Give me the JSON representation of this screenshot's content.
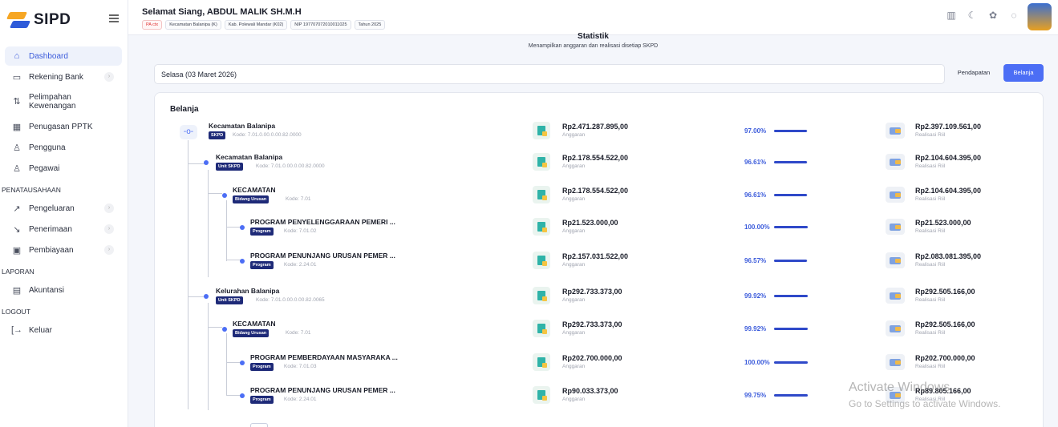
{
  "app": {
    "logo_text": "SIPD"
  },
  "sidebar": {
    "items": [
      {
        "label": "Dashboard",
        "icon": "home-icon"
      },
      {
        "label": "Rekening Bank",
        "icon": "bank-card-icon"
      },
      {
        "label": "Pelimpahan Kewenangan",
        "icon": "delegation-icon"
      },
      {
        "label": "Penugasan PPTK",
        "icon": "table-icon"
      },
      {
        "label": "Pengguna",
        "icon": "user-icon"
      },
      {
        "label": "Pegawai",
        "icon": "users-icon"
      }
    ],
    "section_penatausahaan": "PENATAUSAHAAN",
    "items2": [
      {
        "label": "Pengeluaran",
        "icon": "trend-up-icon"
      },
      {
        "label": "Penerimaan",
        "icon": "trend-down-icon"
      },
      {
        "label": "Pembiayaan",
        "icon": "wallet-icon"
      }
    ],
    "section_laporan": "LAPORAN",
    "akuntansi": "Akuntansi",
    "section_logout": "LOGOUT",
    "keluar": "Keluar"
  },
  "header": {
    "greeting": "Selamat Siang, ABDUL MALIK SH.M.H",
    "chips": [
      "PA ctx",
      "Kecamatan Balanipa (K)",
      "Kab. Polewali Mandar (K02)",
      "NIP 197707072010011025",
      "Tahun 2025"
    ]
  },
  "main": {
    "title": "Statistik",
    "subtitle": "Menampilkan anggaran dan realisasi disetiap SKPD",
    "date_value": "Selasa (03 Maret 2026)",
    "tab_pendapatan": "Pendapatan",
    "tab_belanja": "Belanja",
    "section_title": "Belanja",
    "anggaran_label": "Anggaran",
    "realisasi_label": "Realisasi Riil",
    "rows": [
      {
        "name": "Kecamatan Balanipa",
        "badge": "SKPD",
        "kode": "Kode: 7.01.0.00.0.00.82.0000",
        "anggaran": "Rp2.471.287.895,00",
        "pct": "97.00%",
        "pct_value": 97.0,
        "realisasi": "Rp2.397.109.561,00"
      },
      {
        "name": "Kecamatan Balanipa",
        "badge": "Unit SKPD",
        "kode": "Kode: 7.01.0.00.0.00.82.0000",
        "anggaran": "Rp2.178.554.522,00",
        "pct": "96.61%",
        "pct_value": 96.61,
        "realisasi": "Rp2.104.604.395,00"
      },
      {
        "name": "KECAMATAN",
        "badge": "Bidang Urusan",
        "kode": "Kode: 7.01",
        "anggaran": "Rp2.178.554.522,00",
        "pct": "96.61%",
        "pct_value": 96.61,
        "realisasi": "Rp2.104.604.395,00"
      },
      {
        "name": "PROGRAM PENYELENGGARAAN PEMERI ...",
        "badge": "Program",
        "kode": "Kode: 7.01.02",
        "anggaran": "Rp21.523.000,00",
        "pct": "100.00%",
        "pct_value": 100.0,
        "realisasi": "Rp21.523.000,00"
      },
      {
        "name": "PROGRAM PENUNJANG URUSAN PEMER ...",
        "badge": "Program",
        "kode": "Kode: 2.24.01",
        "anggaran": "Rp2.157.031.522,00",
        "pct": "96.57%",
        "pct_value": 96.57,
        "realisasi": "Rp2.083.081.395,00"
      },
      {
        "name": "Kelurahan Balanipa",
        "badge": "Unit SKPD",
        "kode": "Kode: 7.01.0.00.0.00.82.0065",
        "anggaran": "Rp292.733.373,00",
        "pct": "99.92%",
        "pct_value": 99.92,
        "realisasi": "Rp292.505.166,00"
      },
      {
        "name": "KECAMATAN",
        "badge": "Bidang Urusan",
        "kode": "Kode: 7.01",
        "anggaran": "Rp292.733.373,00",
        "pct": "99.92%",
        "pct_value": 99.92,
        "realisasi": "Rp292.505.166,00"
      },
      {
        "name": "PROGRAM PEMBERDAYAAN MASYARAKA ...",
        "badge": "Program",
        "kode": "Kode: 7.01.03",
        "anggaran": "Rp202.700.000,00",
        "pct": "100.00%",
        "pct_value": 100.0,
        "realisasi": "Rp202.700.000,00"
      },
      {
        "name": "PROGRAM PENUNJANG URUSAN PEMER ...",
        "badge": "Program",
        "kode": "Kode: 2.24.01",
        "anggaran": "Rp90.033.373,00",
        "pct": "99.75%",
        "pct_value": 99.75,
        "realisasi": "Rp89.805.166,00"
      }
    ]
  },
  "watermark": {
    "line1": "Activate Windows",
    "line2": "Go to Settings to activate Windows."
  }
}
